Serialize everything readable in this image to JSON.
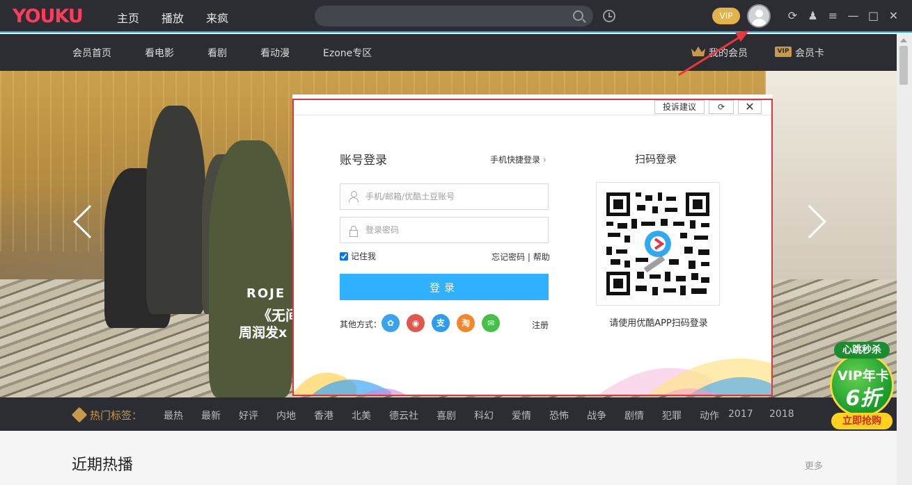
{
  "window": {
    "logo": "YOUKU",
    "nav": [
      "主页",
      "播放",
      "来疯"
    ],
    "vip_badge": "VIP",
    "controls": [
      "⟳",
      "♟",
      "≡",
      "—",
      "□",
      "✕"
    ]
  },
  "subnav": {
    "items": [
      "会员首页",
      "看电影",
      "看剧",
      "看动漫",
      "Ezone专区"
    ],
    "my_vip": "我的会员",
    "vip_card_icon_text": "VIP",
    "vip_card": "会员卡"
  },
  "banner": {
    "poster_line1": "ROJE",
    "poster_line2": "《无间",
    "poster_line3": "周润发x"
  },
  "tags": {
    "label": "热门标签：",
    "items": [
      "最热",
      "最新",
      "好评",
      "内地",
      "香港",
      "北美",
      "德云社",
      "喜剧",
      "科幻",
      "爱情",
      "恐怖",
      "战争",
      "剧情",
      "犯罪",
      "动作",
      "2017",
      "2018"
    ]
  },
  "section": {
    "title": "近期热播",
    "more": "更多"
  },
  "promo": {
    "top": "心跳秒杀",
    "line1": "VIP年卡",
    "line2": "6折",
    "button": "立即抢购"
  },
  "login": {
    "report": "投诉建议",
    "close": "✕",
    "refresh": "⟳",
    "title": "账号登录",
    "phone_login": "手机快捷登录",
    "phone_chevron": "›",
    "account_placeholder": "手机/邮箱/优酷土豆账号",
    "password_placeholder": "登录密码",
    "remember_me": "记住我",
    "forgot_password": "忘记密码",
    "separator": "|",
    "help": "帮助",
    "login_button": "登录",
    "other_methods": "其他方式：",
    "social": [
      {
        "name": "qq",
        "glyph": "✿",
        "color": "#3aa3f0"
      },
      {
        "name": "weibo",
        "glyph": "◉",
        "color": "#e2574c"
      },
      {
        "name": "alipay",
        "glyph": "支",
        "color": "#2e9df0"
      },
      {
        "name": "taobao",
        "glyph": "淘",
        "color": "#f5862c"
      },
      {
        "name": "wechat",
        "glyph": "✉",
        "color": "#47c04a"
      }
    ],
    "register": "注册",
    "qr_title": "扫码登录",
    "qr_hint": "请使用优酷APP扫码登录"
  }
}
